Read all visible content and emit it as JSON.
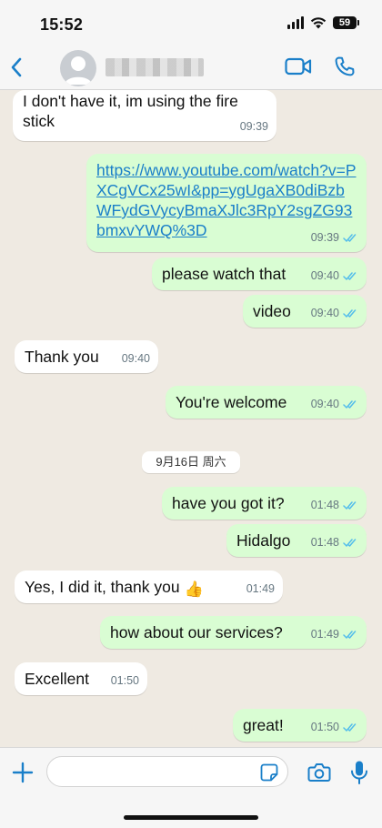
{
  "status_bar": {
    "time": "15:52",
    "battery": "59"
  },
  "header": {
    "contact_name": "",
    "back_icon": "chevron-left-icon",
    "video_icon": "video-camera-icon",
    "call_icon": "phone-icon"
  },
  "messages": [
    {
      "direction": "in",
      "text": "I don't have it, im using the fire stick",
      "time": "09:39"
    },
    {
      "direction": "out",
      "text": "https://www.youtube.com/watch?v=PXCgVCx25wI&pp=ygUgaXB0diBzbWFydGVycyBmaXJlc3RpY2sgZG93bmxvYWQ%3D",
      "time": "09:39",
      "is_link": true
    },
    {
      "direction": "out",
      "text": "please watch that",
      "time": "09:40"
    },
    {
      "direction": "out",
      "text": "video",
      "time": "09:40"
    },
    {
      "direction": "in",
      "text": "Thank you",
      "time": "09:40"
    },
    {
      "direction": "out",
      "text": "You're welcome",
      "time": "09:40"
    },
    {
      "direction": "out",
      "text": "have you got it?",
      "time": "01:48"
    },
    {
      "direction": "out",
      "text": "Hidalgo",
      "time": "01:48"
    },
    {
      "direction": "in",
      "text": "Yes, I did it,  thank you",
      "emoji": "👍",
      "time": "01:49"
    },
    {
      "direction": "out",
      "text": "how about our services?",
      "time": "01:49"
    },
    {
      "direction": "in",
      "text": "Excellent",
      "time": "01:50"
    },
    {
      "direction": "out",
      "text": "great!",
      "time": "01:50"
    }
  ],
  "date_separator": "9月16日 周六",
  "input": {
    "placeholder": "",
    "value": ""
  },
  "colors": {
    "accent": "#1a7fc9",
    "outgoing_bubble": "#d9fdd3",
    "incoming_bubble": "#ffffff",
    "chat_background": "#efeae2",
    "read_ticks": "#53bdeb"
  }
}
